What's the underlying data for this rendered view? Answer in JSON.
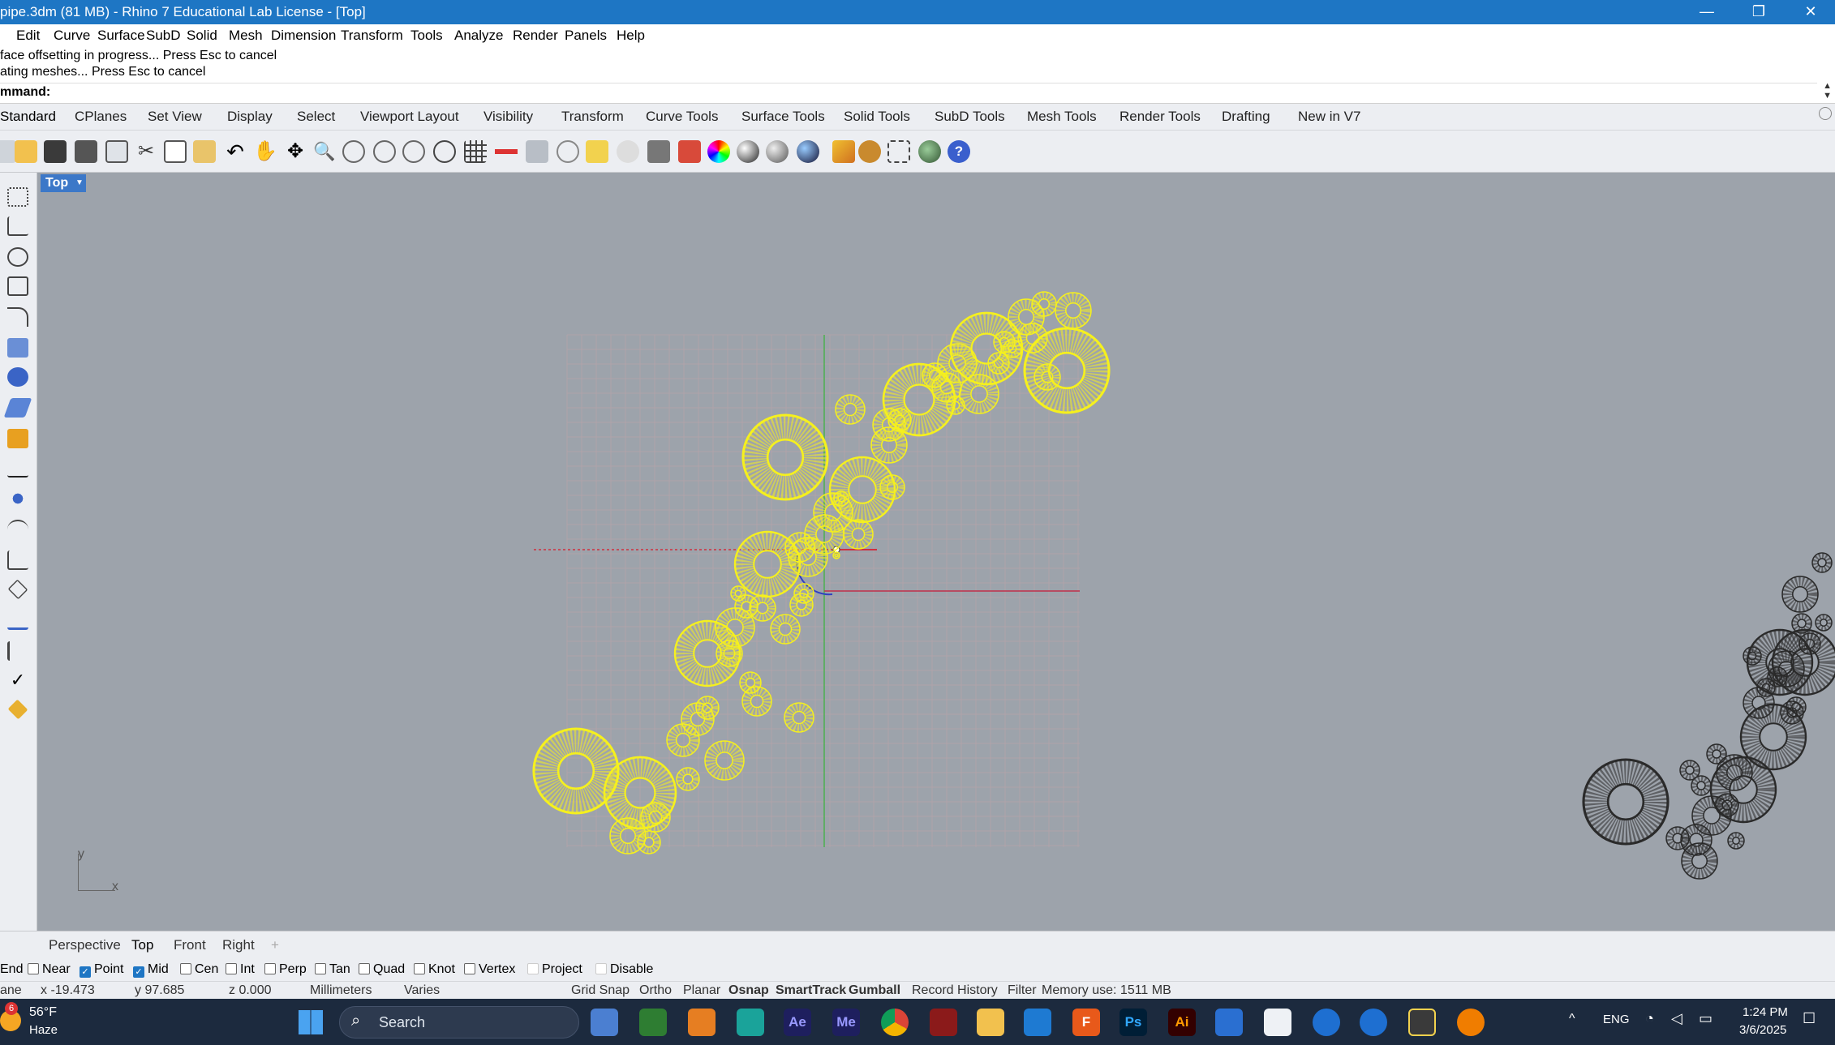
{
  "window": {
    "title": "pipe.3dm (81 MB) - Rhino 7 Educational Lab License - [Top]",
    "minimize": "—",
    "maximize": "❐",
    "close": "✕"
  },
  "menu": [
    "Edit",
    "Curve",
    "Surface",
    "SubD",
    "Solid",
    "Mesh",
    "Dimension",
    "Transform",
    "Tools",
    "Analyze",
    "Render",
    "Panels",
    "Help"
  ],
  "command_history": [
    "face offsetting in progress... Press Esc to cancel",
    "ating meshes... Press Esc to cancel"
  ],
  "command_prompt": "mmand:",
  "toolbar_tabs": [
    "Standard",
    "CPlanes",
    "Set View",
    "Display",
    "Select",
    "Viewport Layout",
    "Visibility",
    "Transform",
    "Curve Tools",
    "Surface Tools",
    "Solid Tools",
    "SubD Tools",
    "Mesh Tools",
    "Render Tools",
    "Drafting",
    "New in V7"
  ],
  "viewport": {
    "name": "Top",
    "axis_y": "y",
    "axis_x": "x"
  },
  "view_tabs": [
    "Perspective",
    "Top",
    "Front",
    "Right"
  ],
  "add_tab": "+",
  "osnaps": [
    {
      "label": "End",
      "checked": null
    },
    {
      "label": "Near",
      "checked": false
    },
    {
      "label": "Point",
      "checked": true
    },
    {
      "label": "Mid",
      "checked": true
    },
    {
      "label": "Cen",
      "checked": false
    },
    {
      "label": "Int",
      "checked": false
    },
    {
      "label": "Perp",
      "checked": false
    },
    {
      "label": "Tan",
      "checked": false
    },
    {
      "label": "Quad",
      "checked": false
    },
    {
      "label": "Knot",
      "checked": false
    },
    {
      "label": "Vertex",
      "checked": false
    },
    {
      "label": "Project",
      "checked": false
    },
    {
      "label": "Disable",
      "checked": false
    }
  ],
  "status": {
    "plane": "ane",
    "x": "x -19.473",
    "y": "y 97.685",
    "z": "z 0.000",
    "units": "Millimeters",
    "layer": "Varies",
    "grid_snap": "Grid Snap",
    "ortho": "Ortho",
    "planar": "Planar",
    "osnap": "Osnap",
    "smarttrack": "SmartTrack",
    "gumball": "Gumball",
    "record_history": "Record History",
    "filter": "Filter",
    "memory": "Memory use: 1511 MB"
  },
  "taskbar": {
    "weather_temp": "56°F",
    "weather_desc": "Haze",
    "weather_badge": "6",
    "search_placeholder": "Search",
    "lang": "ENG",
    "time": "1:24 PM",
    "date": "3/6/2025"
  },
  "colors": {
    "titlebar": "#1e76c4",
    "selected_geometry": "#f5f01e",
    "unselected_geometry": "#2a2a2a",
    "viewport_bg": "#9da3ab"
  }
}
